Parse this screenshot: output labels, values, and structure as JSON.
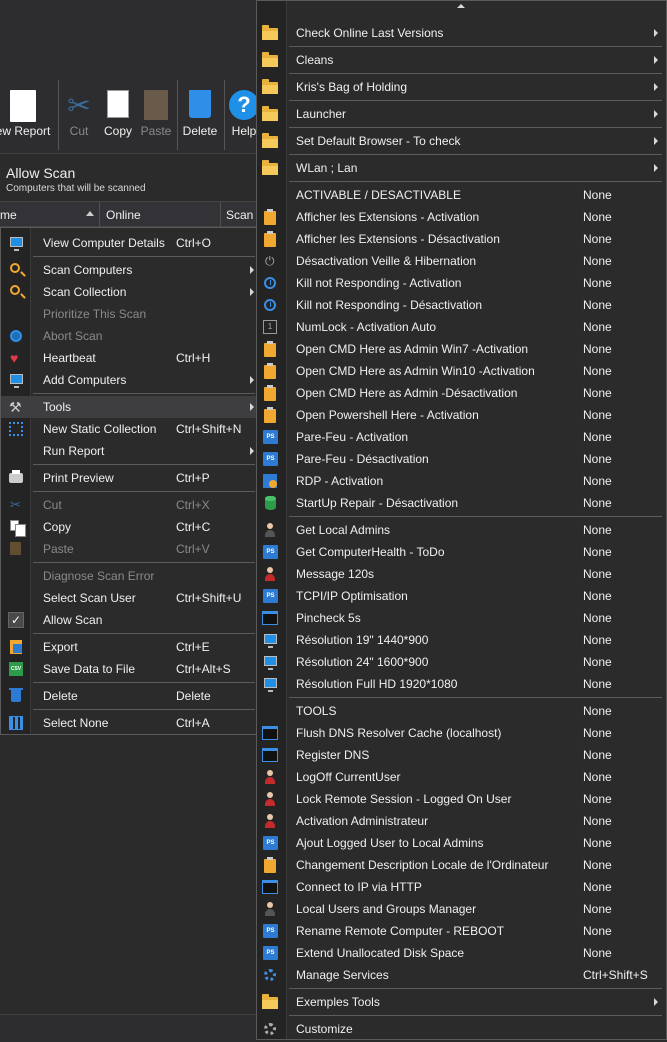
{
  "ribbon": {
    "new_report": "ew Report",
    "cut": "Cut",
    "copy": "Copy",
    "paste": "Paste",
    "delete": "Delete",
    "help": "Help",
    "help_glyph": "?"
  },
  "panel": {
    "title": "Allow Scan",
    "subtitle": "Computers that will be scanned"
  },
  "grid": {
    "col_name": "me",
    "col_online": "Online",
    "col_scan": "Scan"
  },
  "context_menu": [
    {
      "label": "View Computer Details",
      "shortcut": "Ctrl+O",
      "icon": "monitor-icon"
    },
    {
      "sep": true
    },
    {
      "label": "Scan Computers",
      "submenu": true,
      "icon": "search-icon"
    },
    {
      "label": "Scan Collection",
      "submenu": true,
      "icon": "search-collection-icon"
    },
    {
      "label": "Prioritize This Scan",
      "disabled": true
    },
    {
      "label": "Abort Scan",
      "disabled": true,
      "icon": "abort-icon"
    },
    {
      "label": "Heartbeat",
      "shortcut": "Ctrl+H",
      "icon": "heart-icon"
    },
    {
      "label": "Add Computers",
      "submenu": true,
      "icon": "add-computer-icon"
    },
    {
      "sep": true
    },
    {
      "label": "Tools",
      "submenu": true,
      "highlighted": true,
      "icon": "tools-icon"
    },
    {
      "label": "New Static Collection",
      "shortcut": "Ctrl+Shift+N",
      "icon": "collection-icon"
    },
    {
      "label": "Run Report",
      "submenu": true
    },
    {
      "sep": true
    },
    {
      "label": "Print Preview",
      "shortcut": "Ctrl+P",
      "icon": "printer-icon"
    },
    {
      "sep": true
    },
    {
      "label": "Cut",
      "shortcut": "Ctrl+X",
      "disabled": true,
      "icon": "scissors-icon"
    },
    {
      "label": "Copy",
      "shortcut": "Ctrl+C",
      "icon": "copy-icon"
    },
    {
      "label": "Paste",
      "shortcut": "Ctrl+V",
      "disabled": true,
      "icon": "paste-icon"
    },
    {
      "sep": true
    },
    {
      "label": "Diagnose Scan Error",
      "disabled": true
    },
    {
      "label": "Select Scan User",
      "shortcut": "Ctrl+Shift+U"
    },
    {
      "label": "Allow Scan",
      "icon": "check-icon"
    },
    {
      "sep": true
    },
    {
      "label": "Export",
      "shortcut": "Ctrl+E",
      "icon": "export-icon"
    },
    {
      "label": "Save Data to File",
      "shortcut": "Ctrl+Alt+S",
      "icon": "csv-icon"
    },
    {
      "sep": true
    },
    {
      "label": "Delete",
      "shortcut": "Delete",
      "icon": "trash-icon"
    },
    {
      "sep": true
    },
    {
      "label": "Select None",
      "shortcut": "Ctrl+A",
      "icon": "select-none-icon"
    }
  ],
  "tools_menu": [
    {
      "label": "Check Online Last Versions",
      "submenu": true,
      "icon": "folder-icon",
      "sep_after": true
    },
    {
      "label": "Cleans",
      "submenu": true,
      "icon": "folder-icon",
      "sep_after": true
    },
    {
      "label": "Kris's Bag of Holding",
      "submenu": true,
      "icon": "folder-icon",
      "sep_after": true
    },
    {
      "label": "Launcher",
      "submenu": true,
      "icon": "folder-icon",
      "sep_after": true
    },
    {
      "label": "Set Default Browser - To check",
      "submenu": true,
      "icon": "folder-icon",
      "sep_after": true
    },
    {
      "label": "WLan ; Lan",
      "submenu": true,
      "icon": "folder-icon",
      "sep_after": true
    },
    {
      "label": "ACTIVABLE / DESACTIVABLE",
      "shortcut": "None"
    },
    {
      "label": "Afficher les Extensions - Activation",
      "shortcut": "None",
      "icon": "clipboard-icon"
    },
    {
      "label": "Afficher les Extensions - Désactivation",
      "shortcut": "None",
      "icon": "clipboard-icon"
    },
    {
      "label": "Désactivation Veille & Hibernation",
      "shortcut": "None",
      "icon": "plug-icon"
    },
    {
      "label": "Kill not Responding - Activation",
      "shortcut": "None",
      "icon": "clock-icon"
    },
    {
      "label": "Kill not Responding - Désactivation",
      "shortcut": "None",
      "icon": "clock-icon"
    },
    {
      "label": "NumLock - Activation Auto",
      "shortcut": "None",
      "icon": "numlock-icon"
    },
    {
      "label": "Open CMD Here as Admin Win7 -Activation",
      "shortcut": "None",
      "icon": "clipboard-icon"
    },
    {
      "label": "Open CMD Here as Admin Win10 -Activation",
      "shortcut": "None",
      "icon": "clipboard-icon"
    },
    {
      "label": "Open CMD Here as Admin -Désactivation",
      "shortcut": "None",
      "icon": "clipboard-icon"
    },
    {
      "label": "Open Powershell Here - Activation",
      "shortcut": "None",
      "icon": "clipboard-icon"
    },
    {
      "label": "Pare-Feu - Activation",
      "shortcut": "None",
      "icon": "powershell-icon"
    },
    {
      "label": "Pare-Feu - Désactivation",
      "shortcut": "None",
      "icon": "powershell-icon"
    },
    {
      "label": "RDP - Activation",
      "shortcut": "None",
      "icon": "rdp-icon"
    },
    {
      "label": "StartUp Repair - Désactivation",
      "shortcut": "None",
      "icon": "database-icon",
      "sep_after": true
    },
    {
      "label": "Get Local Admins",
      "shortcut": "None",
      "icon": "users-icon"
    },
    {
      "label": "Get ComputerHealth - ToDo",
      "shortcut": "None",
      "icon": "powershell-icon"
    },
    {
      "label": "Message 120s",
      "shortcut": "None",
      "icon": "user-alert-icon"
    },
    {
      "label": "TCPI/IP Optimisation",
      "shortcut": "None",
      "icon": "powershell-icon"
    },
    {
      "label": "Pincheck 5s",
      "shortcut": "None",
      "icon": "terminal-icon"
    },
    {
      "label": "Résolution 19\" 1440*900",
      "shortcut": "None",
      "icon": "monitor-icon"
    },
    {
      "label": "Résolution 24\" 1600*900",
      "shortcut": "None",
      "icon": "monitor-icon"
    },
    {
      "label": "Résolution Full HD 1920*1080",
      "shortcut": "None",
      "icon": "monitor-icon",
      "sep_after": true
    },
    {
      "label": "TOOLS",
      "shortcut": "None"
    },
    {
      "label": "Flush DNS Resolver Cache (localhost)",
      "shortcut": "None",
      "icon": "terminal-icon"
    },
    {
      "label": "Register DNS",
      "shortcut": "None",
      "icon": "terminal-icon"
    },
    {
      "label": "LogOff CurrentUser",
      "shortcut": "None",
      "icon": "user-alert-icon"
    },
    {
      "label": "Lock Remote Session - Logged On User",
      "shortcut": "None",
      "icon": "user-alert-icon"
    },
    {
      "label": "Activation Administrateur",
      "shortcut": "None",
      "icon": "admin-user-icon"
    },
    {
      "label": "Ajout Logged User to Local Admins",
      "shortcut": "None",
      "icon": "powershell-icon"
    },
    {
      "label": "Changement Description Locale de l'Ordinateur",
      "shortcut": "None",
      "icon": "clipboard-icon"
    },
    {
      "label": "Connect to IP via HTTP",
      "shortcut": "None",
      "icon": "terminal-icon"
    },
    {
      "label": "Local Users and Groups Manager",
      "shortcut": "None",
      "icon": "users-icon"
    },
    {
      "label": "Rename Remote Computer - REBOOT",
      "shortcut": "None",
      "icon": "powershell-icon"
    },
    {
      "label": "Extend Unallocated Disk Space",
      "shortcut": "None",
      "icon": "powershell-icon"
    },
    {
      "label": "Manage Services",
      "shortcut": "Ctrl+Shift+S",
      "icon": "services-gear-icon",
      "sep_after": true
    },
    {
      "label": "Exemples Tools",
      "submenu": true,
      "icon": "folder-icon",
      "sep_after": true
    },
    {
      "label": "Customize",
      "icon": "gear-icon"
    }
  ]
}
